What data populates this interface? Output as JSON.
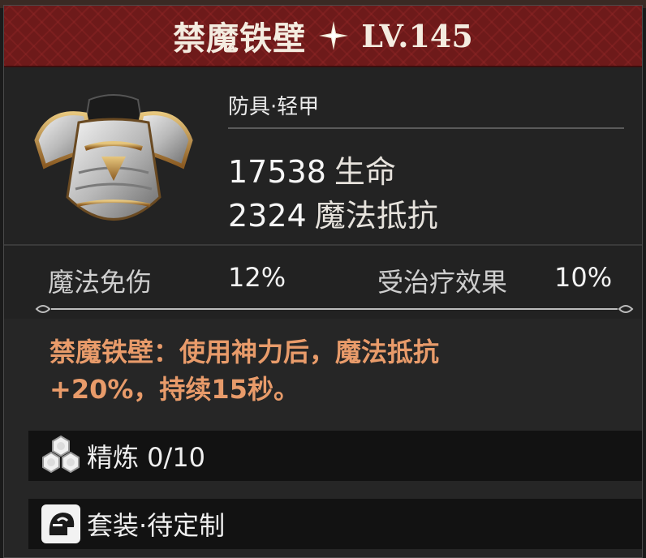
{
  "header": {
    "title": "禁魔铁壁",
    "level": "LV.145"
  },
  "item": {
    "category": "防具·轻甲",
    "stats": [
      {
        "value": "17538",
        "label": "生命"
      },
      {
        "value": "2324",
        "label": "魔法抵抗"
      }
    ]
  },
  "sub_stats": [
    {
      "label": "魔法免伤",
      "value": "12%"
    },
    {
      "label": "受治疗效果",
      "value": "10%"
    }
  ],
  "effect": {
    "line1": "禁魔铁壁：使用神力后，魔法抵抗",
    "line2": "+20%，持续15秒。"
  },
  "refine": {
    "label": "精炼 0/10"
  },
  "set": {
    "label": "套装·待定制"
  },
  "colors": {
    "header_bg": "#6e1a1a",
    "effect_text": "#e89b6a",
    "panel_bg": "#262626"
  },
  "icons": {
    "header": "four-point-star-icon",
    "item": "plate-armor-icon",
    "refine": "hexagon-cluster-icon",
    "set": "helmet-silhouette-icon"
  }
}
